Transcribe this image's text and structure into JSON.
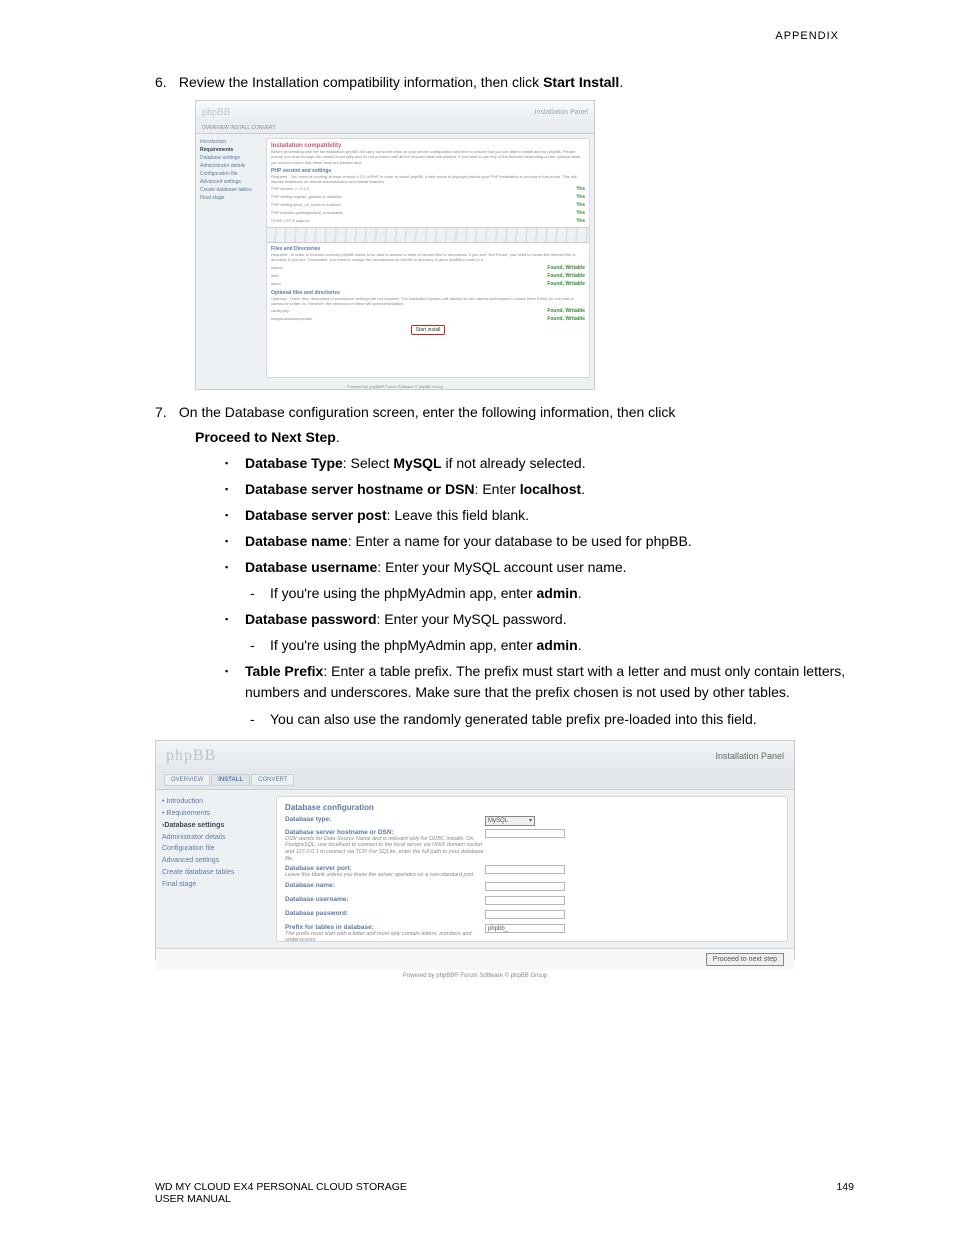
{
  "header": {
    "appendix": "APPENDIX"
  },
  "step6": {
    "num": "6.",
    "text_a": "Review the Installation compatibility information, then click ",
    "text_b": "Start Install",
    "text_c": "."
  },
  "ss1": {
    "logo": "phpBB",
    "panel": "Installation Panel",
    "tabs": "OVERVIEW   INSTALL   CONVERT",
    "side": [
      "Introduction",
      "Requirements",
      "Database settings",
      "Administrator details",
      "Configuration file",
      "Advanced settings",
      "Create database tables",
      "Final stage"
    ],
    "title": "Installation compatibility",
    "intro": "Before proceeding with the full installation phpBB will carry out some tests on your server configuration and files to ensure that you are able to install and run phpBB. Please ensure you read through the results thoroughly and do not proceed until all the required tests are passed. If you wish to use any of the features depending on the optional tests, you should ensure that these tests are passed also.",
    "sec1": "PHP version and settings",
    "req1": "Required - You must be running at least version 4.3.3 of PHP in order to install phpBB. If safe mode is displayed below your PHP installation is running in that mode. This will impose limitations on remote administration and similar features.",
    "rows1": [
      {
        "l": "PHP version >= 4.3.3",
        "r": "Yes"
      },
      {
        "l": "PHP setting register_globals is disabled:",
        "r": "Yes"
      },
      {
        "l": "PHP setting allow_url_fopen is enabled:",
        "r": "Yes"
      },
      {
        "l": "PHP function getimagesize() is available:",
        "r": "Yes"
      },
      {
        "l": "PCRE UTF-8 support:",
        "r": "Yes"
      }
    ],
    "sec2": "Files and Directories",
    "req2": "Required - In order to function correctly phpBB needs to be able to access or write to certain files or directories. If you see \"Not Found\" you need to create the relevant file or directory. If you see \"Unwritable\" you need to change the permissions on the file or directory to allow phpBB to write to it.",
    "rows2": [
      {
        "l": "cache/",
        "r": "Found, Writable"
      },
      {
        "l": "files/",
        "r": "Found, Writable"
      },
      {
        "l": "store/",
        "r": "Found, Writable"
      }
    ],
    "sec3": "Optional files and directories",
    "opt": "Optional - These files, directories or permission settings are not required. The installation system will attempt to use various techniques to create them if they do not exist or cannot be written to. However, the presence of these will speed installation.",
    "rows3": [
      {
        "l": "config.php",
        "r": "Found, Writable"
      },
      {
        "l": "images/avatars/upload/",
        "r": "Found, Writable"
      }
    ],
    "button": "Start install",
    "footer": "Powered by phpBB® Forum Software © phpBB Group"
  },
  "step7": {
    "num": "7.",
    "text_a": "On the Database configuration screen, enter the following information, then click ",
    "text_b": "Proceed to Next Step",
    "text_c": ".",
    "b1_a": "Database Type",
    "b1_b": ": Select ",
    "b1_c": "MySQL",
    "b1_d": " if not already selected.",
    "b2_a": "Database server hostname or DSN",
    "b2_b": ": Enter ",
    "b2_c": "localhost",
    "b2_d": ".",
    "b3_a": "Database server post",
    "b3_b": ": Leave this field blank.",
    "b4_a": "Database name",
    "b4_b": ": Enter a name for your database to be used for phpBB.",
    "b5_a": "Database username",
    "b5_b": ": Enter your MySQL account user name.",
    "b5s_a": "If you're using the phpMyAdmin app, enter ",
    "b5s_b": "admin",
    "b5s_c": ".",
    "b6_a": "Database password",
    "b6_b": ": Enter your MySQL password.",
    "b6s_a": "If you're using the phpMyAdmin app, enter ",
    "b6s_b": "admin",
    "b6s_c": ".",
    "b7_a": "Table Prefix",
    "b7_b": ": Enter a table prefix. The prefix must start with a letter and must only contain letters, numbers and underscores. Make sure that the prefix chosen is not used by other tables.",
    "b7s": "You can also use the randomly generated table prefix pre-loaded into this field."
  },
  "ss2": {
    "logo": "phpBB",
    "panel": "Installation Panel",
    "tabs": [
      "OVERVIEW",
      "INSTALL",
      "CONVERT"
    ],
    "side": [
      "• Introduction",
      "• Requirements",
      "›Database settings",
      "Administrator details",
      "Configuration file",
      "Advanced settings",
      "Create database tables",
      "Final stage"
    ],
    "heading": "Database configuration",
    "rows": [
      {
        "label": "Database type:",
        "help": "",
        "field": "select",
        "value": "MySQL"
      },
      {
        "label": "Database server hostname or DSN:",
        "help": "DSN stands for Data Source Name and is relevant only for ODBC installs. On PostgreSQL, use localhost to connect to the local server via UNIX domain socket and 127.0.0.1 to connect via TCP. For SQLite, enter the full path to your database file.",
        "field": "text",
        "value": ""
      },
      {
        "label": "Database server port:",
        "help": "Leave this blank unless you know the server operates on a non-standard port.",
        "field": "text",
        "value": ""
      },
      {
        "label": "Database name:",
        "help": "",
        "field": "text",
        "value": ""
      },
      {
        "label": "Database username:",
        "help": "",
        "field": "text",
        "value": ""
      },
      {
        "label": "Database password:",
        "help": "",
        "field": "text",
        "value": ""
      },
      {
        "label": "Prefix for tables in database:",
        "help": "The prefix must start with a letter and must only contain letters, numbers and underscores.",
        "field": "text",
        "value": "phpbb_"
      }
    ],
    "proceed": "Proceed to next step",
    "footer": "Powered by phpBB® Forum Software © phpBB Group"
  },
  "footer": {
    "left1": "WD MY CLOUD EX4 PERSONAL CLOUD STORAGE",
    "left2": "USER MANUAL",
    "right": "149"
  }
}
